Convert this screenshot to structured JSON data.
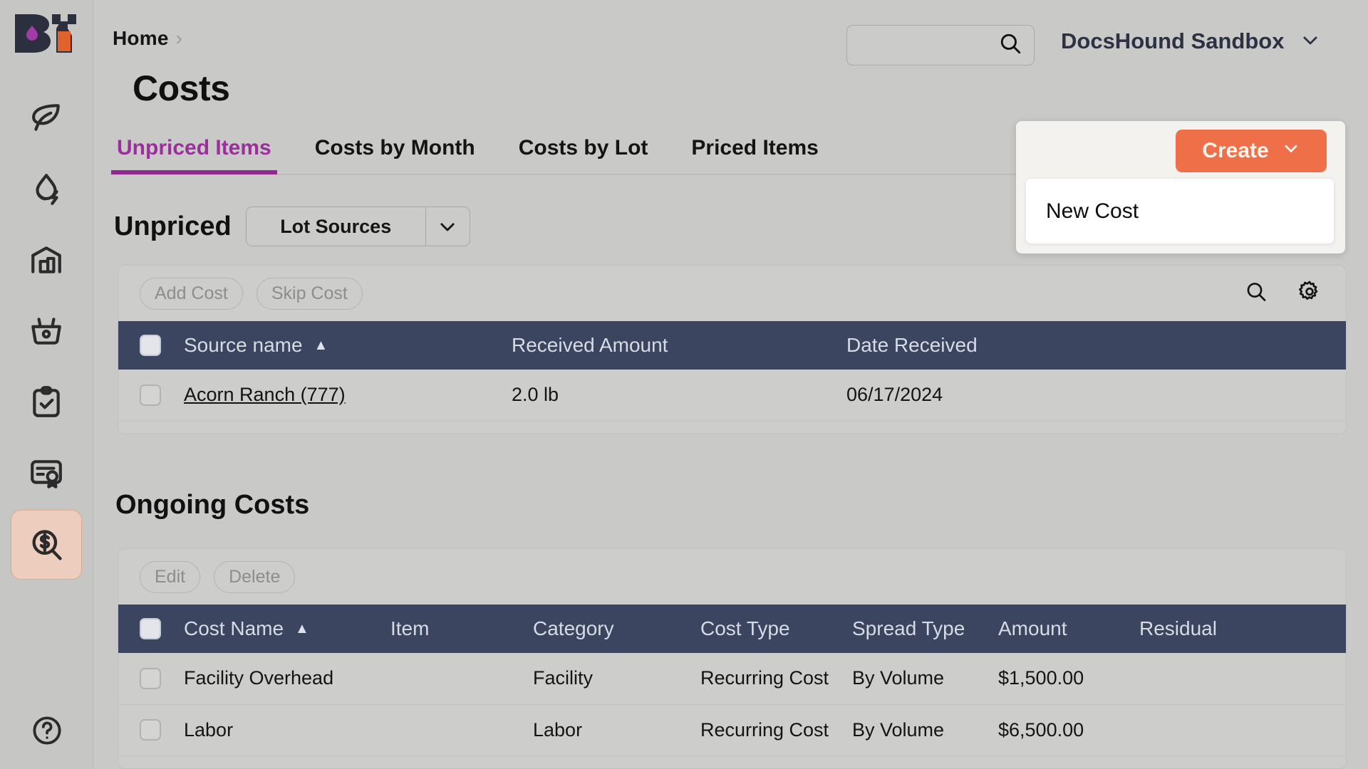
{
  "sidebar": {
    "logo_name": "brand-logo",
    "items": [
      {
        "name": "sidebar-item-cultivation",
        "icon": "leaf-icon",
        "label": "Cultivation",
        "active": false
      },
      {
        "name": "sidebar-item-processing",
        "icon": "droplet-bolt-icon",
        "label": "Processing",
        "active": false
      },
      {
        "name": "sidebar-item-inventory",
        "icon": "warehouse-icon",
        "label": "Inventory",
        "active": false
      },
      {
        "name": "sidebar-item-retail",
        "icon": "basket-icon",
        "label": "Retail",
        "active": false
      },
      {
        "name": "sidebar-item-tasks",
        "icon": "clipboard-check-icon",
        "label": "Tasks",
        "active": false
      },
      {
        "name": "sidebar-item-compliance",
        "icon": "certificate-icon",
        "label": "Compliance",
        "active": false
      },
      {
        "name": "sidebar-item-costs",
        "icon": "dollar-search-icon",
        "label": "Costs",
        "active": true
      }
    ],
    "help": {
      "name": "help-icon",
      "label": "Help"
    }
  },
  "header": {
    "breadcrumb": [
      {
        "label": "Home"
      }
    ],
    "breadcrumb_separator": "›",
    "page_title": "Costs",
    "search": {
      "value": "",
      "placeholder": "",
      "icon": "search-icon"
    },
    "org": {
      "name": "DocsHound Sandbox",
      "chevron": "chevron-down-icon"
    }
  },
  "tabs": [
    {
      "label": "Unpriced Items",
      "active": true
    },
    {
      "label": "Costs by Month",
      "active": false
    },
    {
      "label": "Costs by Lot",
      "active": false
    },
    {
      "label": "Priced Items",
      "active": false
    }
  ],
  "create": {
    "button_label": "Create",
    "chevron": "chevron-down-icon",
    "menu_items": [
      {
        "label": "New Cost"
      }
    ],
    "accent_color": "#ef7048"
  },
  "unpriced_section": {
    "title": "Unpriced",
    "filter": {
      "selected": "Lot Sources",
      "chevron": "chevron-down-icon"
    },
    "toolbar": {
      "buttons": [
        {
          "label": "Add Cost"
        },
        {
          "label": "Skip Cost"
        }
      ],
      "icons": [
        {
          "name": "search-icon"
        },
        {
          "name": "gear-icon"
        }
      ]
    },
    "table": {
      "columns": [
        "Source name",
        "Received Amount",
        "Date Received"
      ],
      "sort_column": "Source name",
      "sort_direction": "asc",
      "sort_glyph": "▲",
      "rows": [
        {
          "source_name": "Acorn Ranch (777)",
          "received_amount": "2.0 lb",
          "date_received": "06/17/2024"
        }
      ]
    }
  },
  "ongoing_section": {
    "title": "Ongoing Costs",
    "toolbar": {
      "buttons": [
        {
          "label": "Edit"
        },
        {
          "label": "Delete"
        }
      ]
    },
    "table": {
      "columns": [
        "Cost Name",
        "Item",
        "Category",
        "Cost Type",
        "Spread Type",
        "Amount",
        "Residual"
      ],
      "sort_column": "Cost Name",
      "sort_direction": "asc",
      "sort_glyph": "▲",
      "rows": [
        {
          "cost_name": "Facility Overhead",
          "item": "",
          "category": "Facility",
          "cost_type": "Recurring Cost",
          "spread_type": "By Volume",
          "amount": "$1,500.00",
          "residual": ""
        },
        {
          "cost_name": "Labor",
          "item": "",
          "category": "Labor",
          "cost_type": "Recurring Cost",
          "spread_type": "By Volume",
          "amount": "$6,500.00",
          "residual": ""
        }
      ]
    }
  },
  "colors": {
    "page_bg": "#c9c9c7",
    "table_header": "#3b4560",
    "accent_orange": "#ef7048",
    "active_tab_purple": "#8e2a8e",
    "active_nav_bg": "#eccdbe"
  }
}
